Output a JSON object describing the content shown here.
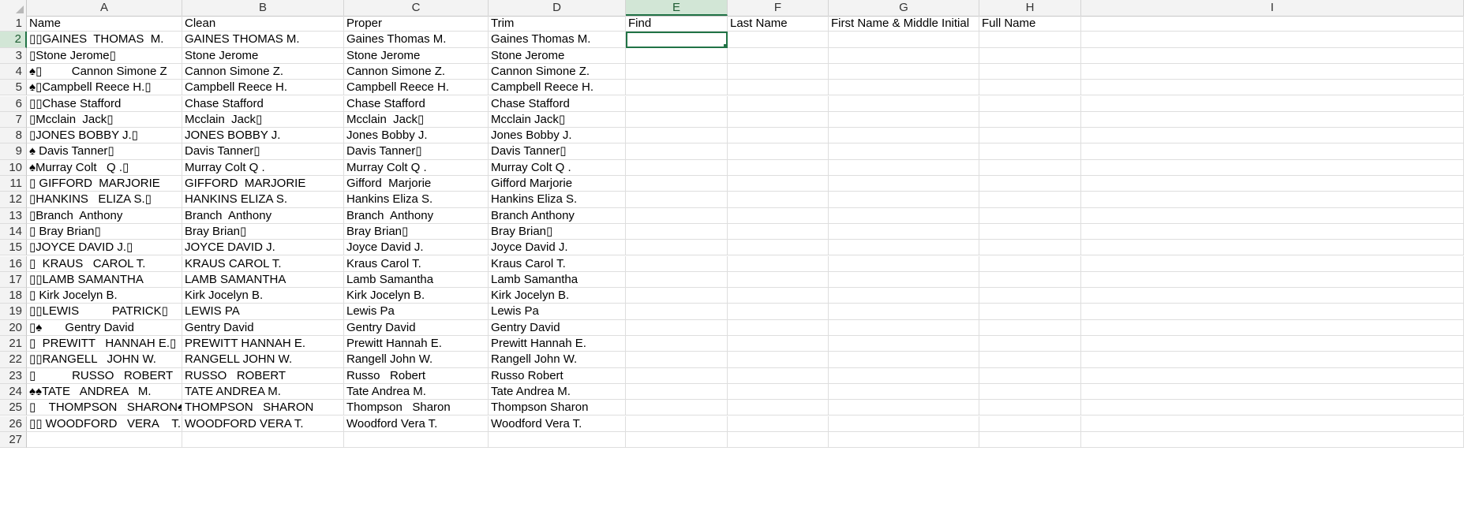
{
  "columns": [
    "A",
    "B",
    "C",
    "D",
    "E",
    "F",
    "G",
    "H",
    "I"
  ],
  "active_column": "E",
  "active_row": 2,
  "selected_cell": "E2",
  "rows": [
    {
      "n": "1",
      "cells": [
        "Name",
        "Clean",
        "Proper",
        "Trim",
        "Find",
        "Last Name",
        "First Name & Middle Initial",
        "Full Name",
        ""
      ]
    },
    {
      "n": "2",
      "cells": [
        "▯▯GAINES  THOMAS  M.",
        "GAINES THOMAS M.",
        "Gaines Thomas M.",
        "Gaines Thomas M.",
        "",
        "",
        "",
        "",
        ""
      ]
    },
    {
      "n": "3",
      "cells": [
        "▯Stone Jerome▯",
        "Stone Jerome",
        "Stone Jerome",
        "Stone Jerome",
        "",
        "",
        "",
        "",
        ""
      ]
    },
    {
      "n": "4",
      "cells": [
        "♠▯         Cannon Simone Z",
        "Cannon Simone Z.",
        "Cannon Simone Z.",
        "Cannon Simone Z.",
        "",
        "",
        "",
        "",
        ""
      ]
    },
    {
      "n": "5",
      "cells": [
        "♠▯Campbell Reece H.▯",
        "Campbell Reece H.",
        "Campbell Reece H.",
        "Campbell Reece H.",
        "",
        "",
        "",
        "",
        ""
      ]
    },
    {
      "n": "6",
      "cells": [
        "▯▯Chase Stafford",
        "Chase Stafford",
        "Chase Stafford",
        "Chase Stafford",
        "",
        "",
        "",
        "",
        ""
      ]
    },
    {
      "n": "7",
      "cells": [
        "▯Mcclain  Jack▯",
        "Mcclain  Jack▯",
        "Mcclain  Jack▯",
        "Mcclain Jack▯",
        "",
        "",
        "",
        "",
        ""
      ]
    },
    {
      "n": "8",
      "cells": [
        "▯JONES BOBBY J.▯",
        "JONES BOBBY J.",
        "Jones Bobby J.",
        "Jones Bobby J.",
        "",
        "",
        "",
        "",
        ""
      ]
    },
    {
      "n": "9",
      "cells": [
        "♠ Davis Tanner▯",
        "Davis Tanner▯",
        "Davis Tanner▯",
        "Davis Tanner▯",
        "",
        "",
        "",
        "",
        ""
      ]
    },
    {
      "n": "10",
      "cells": [
        "♠Murray Colt   Q .▯",
        "Murray Colt Q .",
        "Murray Colt Q .",
        "Murray Colt Q .",
        "",
        "",
        "",
        "",
        ""
      ]
    },
    {
      "n": "11",
      "cells": [
        "▯ GIFFORD  MARJORIE",
        "GIFFORD  MARJORIE",
        "Gifford  Marjorie",
        "Gifford Marjorie",
        "",
        "",
        "",
        "",
        ""
      ]
    },
    {
      "n": "12",
      "cells": [
        "▯HANKINS   ELIZA S.▯",
        "HANKINS ELIZA S.",
        "Hankins Eliza S.",
        "Hankins Eliza S.",
        "",
        "",
        "",
        "",
        ""
      ]
    },
    {
      "n": "13",
      "cells": [
        "▯Branch  Anthony",
        "Branch  Anthony",
        "Branch  Anthony",
        "Branch Anthony",
        "",
        "",
        "",
        "",
        ""
      ]
    },
    {
      "n": "14",
      "cells": [
        "▯ Bray Brian▯",
        "Bray Brian▯",
        "Bray Brian▯",
        "Bray Brian▯",
        "",
        "",
        "",
        "",
        ""
      ]
    },
    {
      "n": "15",
      "cells": [
        "▯JOYCE DAVID J.▯",
        "JOYCE DAVID J.",
        "Joyce David J.",
        "Joyce David J.",
        "",
        "",
        "",
        "",
        ""
      ]
    },
    {
      "n": "16",
      "cells": [
        "▯  KRAUS   CAROL T.",
        "KRAUS CAROL T.",
        "Kraus Carol T.",
        "Kraus Carol T.",
        "",
        "",
        "",
        "",
        ""
      ]
    },
    {
      "n": "17",
      "cells": [
        "▯▯LAMB SAMANTHA",
        "LAMB SAMANTHA",
        "Lamb Samantha",
        "Lamb Samantha",
        "",
        "",
        "",
        "",
        ""
      ]
    },
    {
      "n": "18",
      "cells": [
        "▯ Kirk Jocelyn B.",
        "Kirk Jocelyn B.",
        "Kirk Jocelyn B.",
        "Kirk Jocelyn B.",
        "",
        "",
        "",
        "",
        ""
      ]
    },
    {
      "n": "19",
      "cells": [
        "▯▯LEWIS          PATRICK▯",
        "LEWIS PA",
        "Lewis Pa",
        "Lewis Pa",
        "",
        "",
        "",
        "",
        ""
      ]
    },
    {
      "n": "20",
      "cells": [
        "▯♠       Gentry David",
        "Gentry David",
        "Gentry David",
        "Gentry David",
        "",
        "",
        "",
        "",
        ""
      ]
    },
    {
      "n": "21",
      "cells": [
        "▯  PREWITT   HANNAH E.▯",
        "PREWITT HANNAH E.",
        "Prewitt Hannah E.",
        "Prewitt Hannah E.",
        "",
        "",
        "",
        "",
        ""
      ]
    },
    {
      "n": "22",
      "cells": [
        "▯▯RANGELL   JOHN W.",
        "RANGELL JOHN W.",
        "Rangell John W.",
        "Rangell John W.",
        "",
        "",
        "",
        "",
        ""
      ]
    },
    {
      "n": "23",
      "cells": [
        "▯           RUSSO   ROBERT",
        "RUSSO   ROBERT",
        "Russo   Robert",
        "Russo Robert",
        "",
        "",
        "",
        "",
        ""
      ]
    },
    {
      "n": "24",
      "cells": [
        "♠♠TATE   ANDREA   M.",
        "TATE ANDREA M.",
        "Tate Andrea M.",
        "Tate Andrea M.",
        "",
        "",
        "",
        "",
        ""
      ]
    },
    {
      "n": "25",
      "cells": [
        "▯    THOMPSON   SHARON♠",
        "THOMPSON   SHARON",
        "Thompson   Sharon",
        "Thompson Sharon",
        "",
        "",
        "",
        "",
        ""
      ]
    },
    {
      "n": "26",
      "cells": [
        "▯▯ WOODFORD   VERA    T.",
        "WOODFORD VERA T.",
        "Woodford Vera T.",
        "Woodford Vera T.",
        "",
        "",
        "",
        "",
        ""
      ]
    },
    {
      "n": "27",
      "cells": [
        "",
        "",
        "",
        "",
        "",
        "",
        "",
        "",
        ""
      ]
    }
  ]
}
